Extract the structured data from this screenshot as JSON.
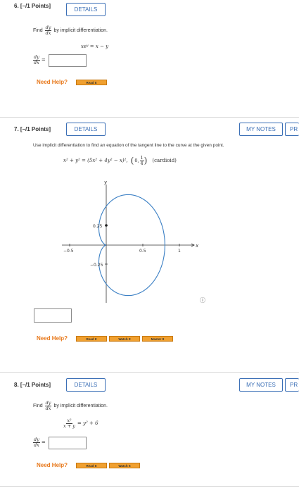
{
  "q6": {
    "number": "6.",
    "points": "[–/1 Points]",
    "details": "DETAILS",
    "find": "Find",
    "dy": "dy",
    "dx": "dx",
    "method": "by implicit differentiation.",
    "equation": "xeʸ = x − y",
    "answer_value": "",
    "need_help": "Need Help?",
    "help_buttons": [
      "Read It"
    ]
  },
  "q7": {
    "number": "7.",
    "points": "[–/1 Points]",
    "details": "DETAILS",
    "my_notes": "MY NOTES",
    "partial_btn": "PR",
    "instruction": "Use implicit differentiation to find an equation of the tangent line to the curve at the given point.",
    "equation": "x² + y² = (5x² + 4y² − x)²,",
    "point_open": "0,",
    "point_num": "1",
    "point_den": "4",
    "curve_name": "(cardioid)",
    "graph": {
      "y_label": "y",
      "x_label": "x",
      "x_ticks": [
        "−0.5",
        "0.5",
        "1"
      ],
      "y_ticks": [
        "0.25",
        "−0.25"
      ],
      "info_icon": "ⓘ"
    },
    "answer_value": "",
    "need_help": "Need Help?",
    "help_buttons": [
      "Read It",
      "Watch It",
      "Master It"
    ]
  },
  "q8": {
    "number": "8.",
    "points": "[–/1 Points]",
    "details": "DETAILS",
    "my_notes": "MY NOTES",
    "partial_btn": "PR",
    "find": "Find",
    "dy": "dy",
    "dx": "dx",
    "method": "by implicit differentiation.",
    "lhs_num": "x²",
    "lhs_den": "x + y",
    "rhs": "= y² + 6",
    "answer_value": "",
    "need_help": "Need Help?",
    "help_buttons": [
      "Read It",
      "Watch It"
    ]
  },
  "colors": {
    "accent_blue": "#3b6fb6",
    "need_help_orange": "#e8791c",
    "help_button": "#f0a030",
    "curve_blue": "#3a7fc4"
  }
}
